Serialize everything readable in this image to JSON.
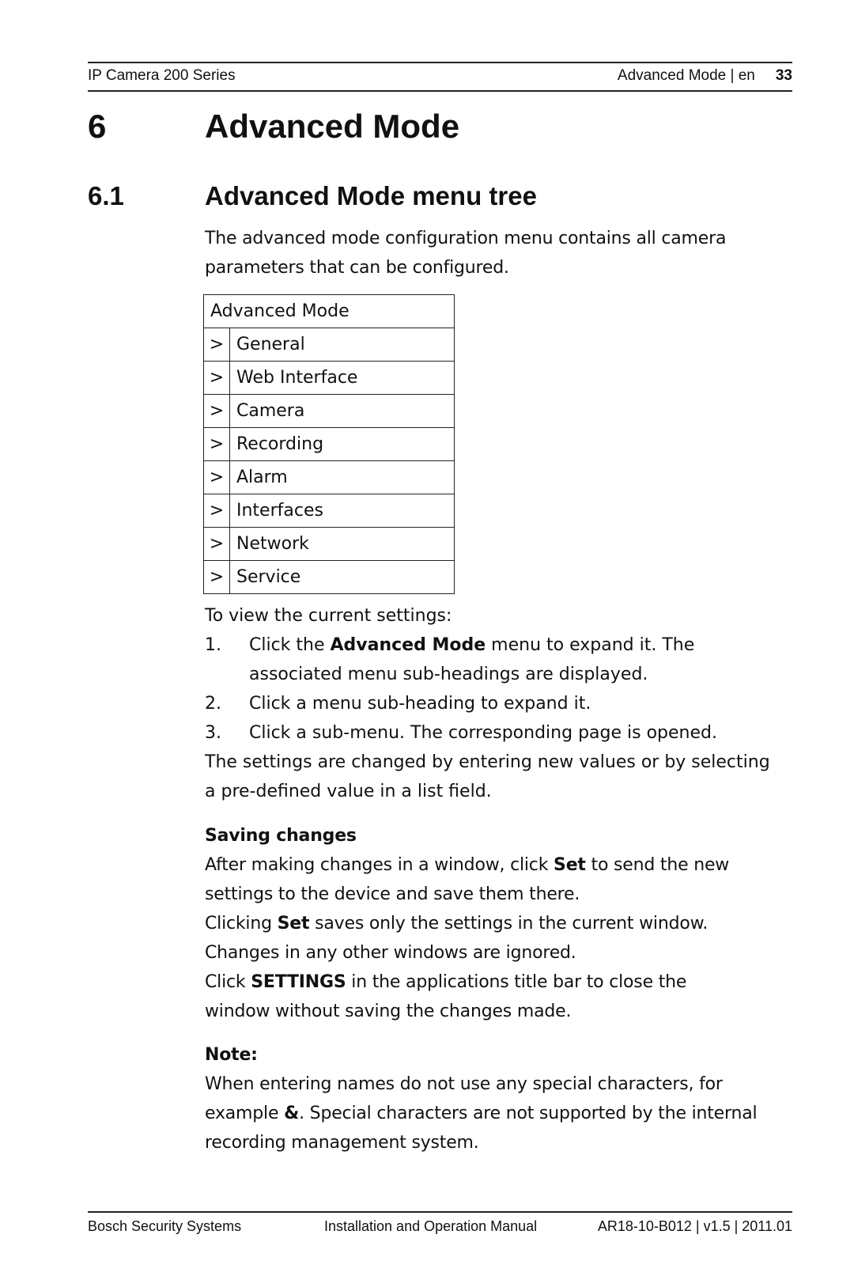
{
  "header": {
    "product": "IP Camera 200 Series",
    "section": "Advanced Mode | en",
    "page_number": "33"
  },
  "chapter": {
    "number": "6",
    "title": "Advanced Mode"
  },
  "section": {
    "number": "6.1",
    "title": "Advanced Mode menu tree"
  },
  "intro": {
    "line1": "The advanced mode configuration menu contains all camera",
    "line2": "parameters that can be configured."
  },
  "menu_tree": {
    "root": "Advanced Mode",
    "chevron": ">",
    "items": [
      "General",
      "Web Interface",
      "Camera",
      "Recording",
      "Alarm",
      "Interfaces",
      "Network",
      "Service"
    ]
  },
  "view_settings": {
    "lead": "To view the current settings:",
    "steps": [
      {
        "n": "1.",
        "pre": "Click the ",
        "bold": "Advanced Mode",
        "post": " menu to expand it. The",
        "line2": "associated menu sub-headings are displayed."
      },
      {
        "n": "2.",
        "text": "Click a menu sub-heading to expand it."
      },
      {
        "n": "3.",
        "text": "Click a sub-menu. The corresponding page is opened."
      }
    ],
    "after_line1": "The settings are changed by entering new values or by selecting",
    "after_line2": "a pre-defined value in a list field."
  },
  "saving": {
    "heading": "Saving changes",
    "p1_pre": "After making changes in a window, click ",
    "p1_bold": "Set",
    "p1_post": " to send the new",
    "p1_line2": "settings to the device and save them there.",
    "p2_pre": "Clicking ",
    "p2_bold": "Set",
    "p2_post": " saves only the settings in the current window.",
    "p2_line2": "Changes in any other windows are ignored.",
    "p3_pre": "Click ",
    "p3_bold": "SETTINGS",
    "p3_post": " in the applications title bar to close the",
    "p3_line2": "window without saving the changes made."
  },
  "note": {
    "heading": "Note:",
    "line1": "When entering names do not use any special characters, for",
    "line2_pre": "example ",
    "line2_bold": "&",
    "line2_post": ". Special characters are not supported by the internal",
    "line3": "recording management system."
  },
  "footer": {
    "company": "Bosch Security Systems",
    "manual": "Installation and Operation Manual",
    "doc_id": "AR18-10-B012 | v1.5 | 2011.01"
  }
}
